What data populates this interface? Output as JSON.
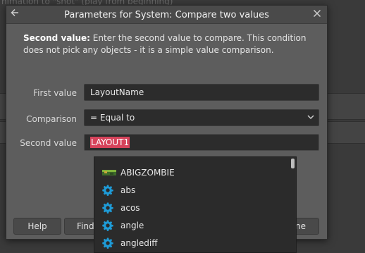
{
  "background": {
    "top_text": "nimation to \"shot\" (play from beginning)"
  },
  "dialog": {
    "title": "Parameters for System: Compare two values",
    "back_icon": "arrow-left-icon",
    "close_icon": "close-icon",
    "description_bold": "Second value:",
    "description_text": " Enter the second value to compare. This condition does not pick any objects - it is a simple value comparison."
  },
  "fields": {
    "first_value": {
      "label": "First value",
      "value": "LayoutName"
    },
    "comparison": {
      "label": "Comparison",
      "value": "= Equal to"
    },
    "second_value": {
      "label": "Second value",
      "value": "LAYOUT1"
    }
  },
  "buttons": {
    "help": "Help",
    "find": "Find",
    "done_partial": "ne"
  },
  "autocomplete": {
    "items": [
      {
        "label": "ABIGZOMBIE",
        "icon": "layout-icon"
      },
      {
        "label": "abs",
        "icon": "gear-icon"
      },
      {
        "label": "acos",
        "icon": "gear-icon"
      },
      {
        "label": "angle",
        "icon": "gear-icon"
      },
      {
        "label": "anglediff",
        "icon": "gear-icon"
      }
    ]
  },
  "colors": {
    "gear_icon": "#1e9bd7",
    "selection": "#d6435b",
    "dialog_bg": "#5d5d5d",
    "field_bg": "#2c2c2c"
  }
}
